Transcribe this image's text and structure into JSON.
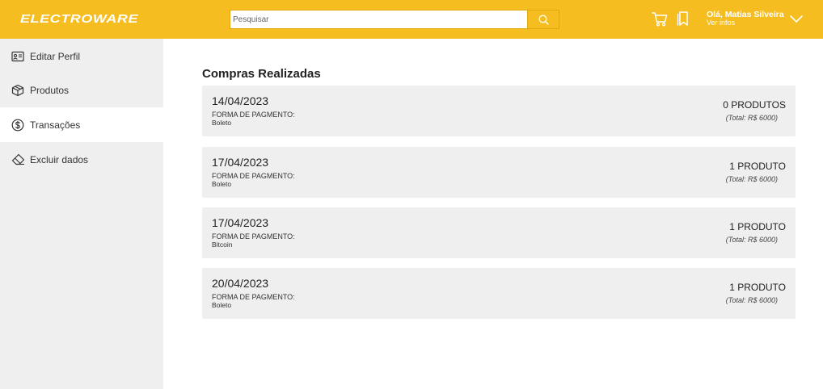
{
  "header": {
    "logo_text": "ELECTROWARE",
    "search": {
      "placeholder": "Pesquisar"
    },
    "icons": {
      "cart": "cart-icon",
      "bookmark": "bookmark-icon",
      "search": "search-icon"
    },
    "user": {
      "greeting": "Olá, Matias Silveira",
      "subtitle": "Ver infos"
    }
  },
  "sidebar": {
    "items": [
      {
        "label": "Editar Perfil",
        "icon": "id-card-icon",
        "active": false
      },
      {
        "label": "Produtos",
        "icon": "package-icon",
        "active": false
      },
      {
        "label": "Transações",
        "icon": "dollar-circle-icon",
        "active": true
      },
      {
        "label": "Excluir dados",
        "icon": "eraser-icon",
        "active": false
      }
    ]
  },
  "main": {
    "title": "Compras Realizadas",
    "purchases": [
      {
        "date": "14/04/2023",
        "payment_label": "FORMA DE PAGMENTO:",
        "payment_method": "Boleto",
        "count": "0 PRODUTOS",
        "total": "(Total: R$ 6000)"
      },
      {
        "date": "17/04/2023",
        "payment_label": "FORMA DE PAGMENTO:",
        "payment_method": "Boleto",
        "count": "1 PRODUTO",
        "total": "(Total: R$ 6000)"
      },
      {
        "date": "17/04/2023",
        "payment_label": "FORMA DE PAGMENTO:",
        "payment_method": "Bitcoin",
        "count": "1 PRODUTO",
        "total": "(Total: R$ 6000)"
      },
      {
        "date": "20/04/2023",
        "payment_label": "FORMA DE PAGMENTO:",
        "payment_method": "Boleto",
        "count": "1 PRODUTO",
        "total": "(Total: R$ 6000)"
      }
    ]
  },
  "colors": {
    "accent": "#f5bd1f",
    "sidebar_bg": "#efefef",
    "card_bg": "#efefef"
  }
}
